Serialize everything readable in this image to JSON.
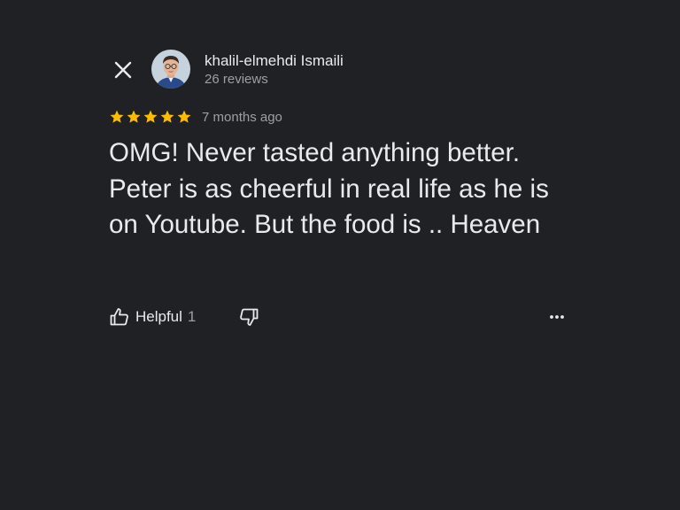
{
  "review": {
    "author": {
      "name": "khalil-elmehdi Ismaili",
      "reviews": "26 reviews"
    },
    "rating": 5,
    "rating_max": 5,
    "time_ago": "7 months ago",
    "text": "OMG! Never tasted anything better. Peter is as cheerful in real life as he is on Youtube. But the food is .. Heaven"
  },
  "actions": {
    "helpful_label": "Helpful",
    "helpful_count": "1"
  },
  "icons": {
    "close": "close-icon",
    "thumbs_up": "thumbs-up-icon",
    "thumbs_down": "thumbs-down-icon",
    "more": "more-horizontal-icon",
    "star": "star-icon"
  },
  "colors": {
    "background": "#202124",
    "text_primary": "#e8eaed",
    "text_secondary": "#9aa0a6",
    "star": "#fbbc04"
  }
}
